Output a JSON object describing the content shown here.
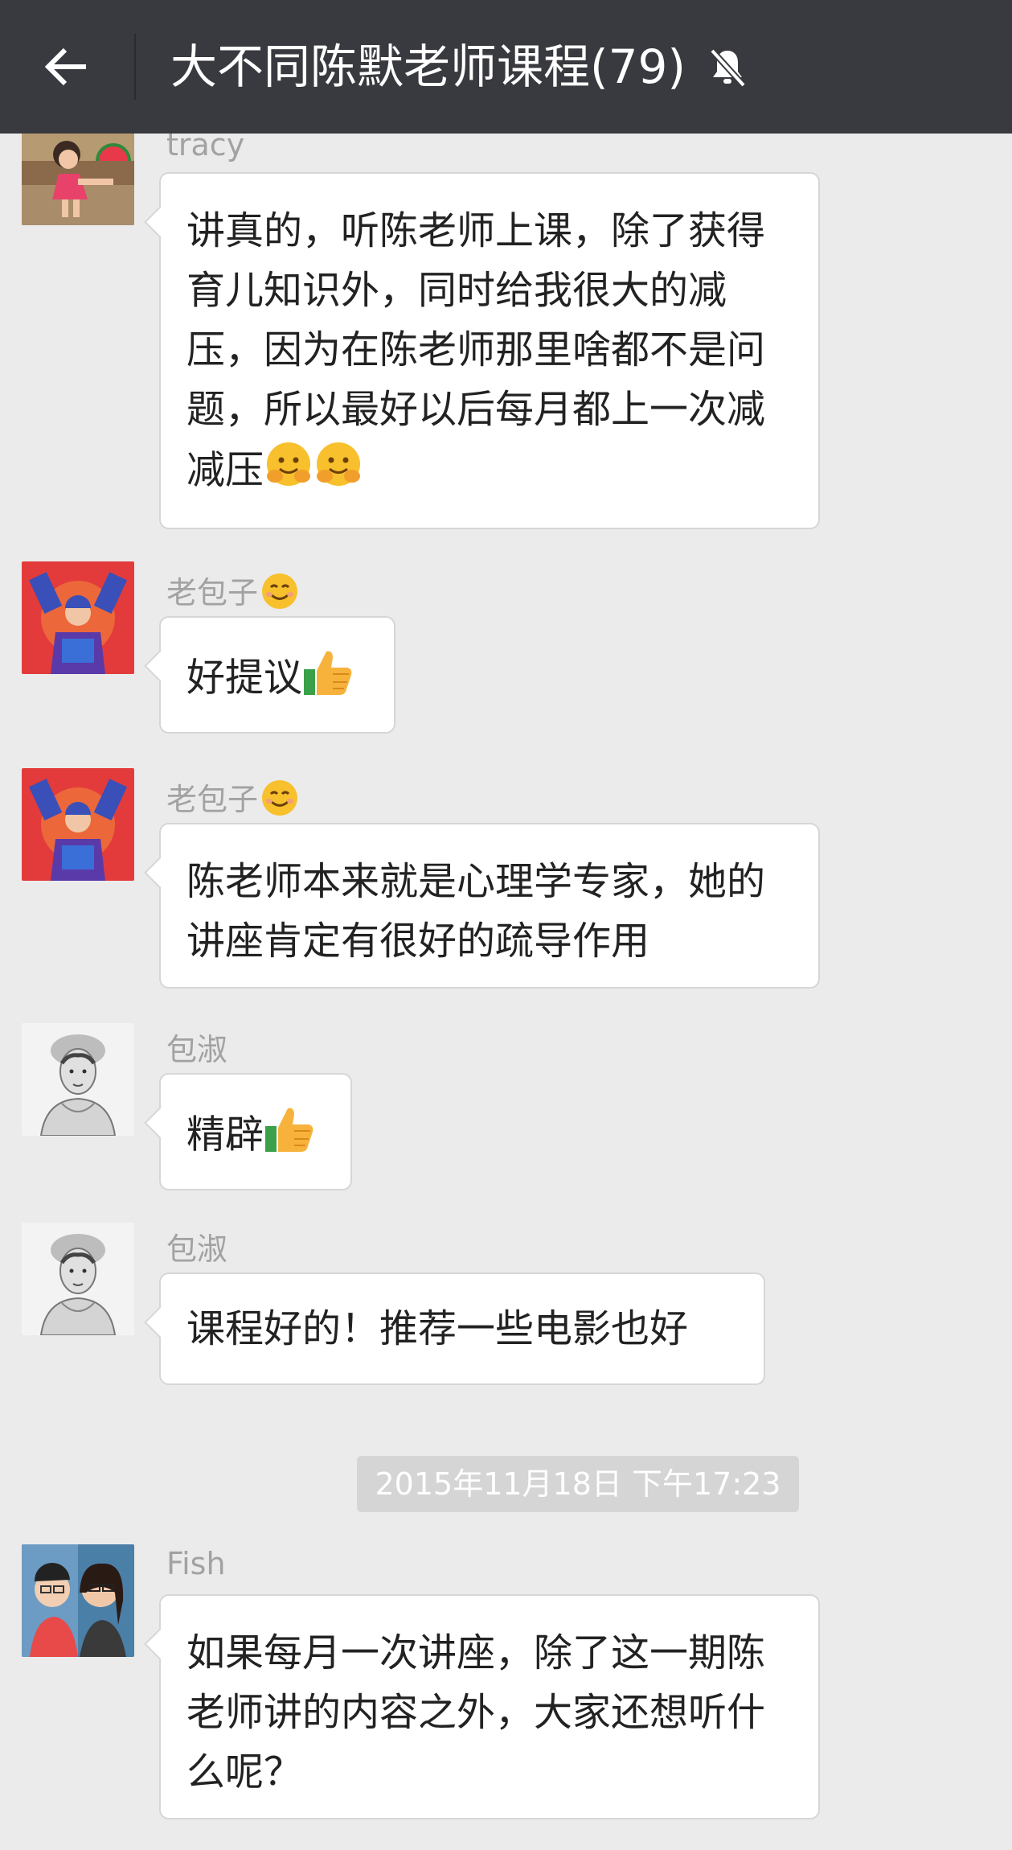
{
  "header": {
    "title": "大不同陈默老师课程(79)",
    "back_icon": "arrow-left-icon",
    "mute_icon": "bell-muted-icon"
  },
  "messages": [
    {
      "sender": "tracy",
      "avatar": "girl-with-watermelon-photo",
      "text": "讲真的，听陈老师上课，除了获得育儿知识外，同时给我很大的减压，因为在陈老师那里啥都不是问题，所以最好以后每月都上一次减减压",
      "emoji": [
        "hugging-face-emoji",
        "hugging-face-emoji"
      ]
    },
    {
      "sender": "老包子",
      "avatar": "child-in-blue-costume-photo",
      "name_emoji": "smiling-face-emoji",
      "text": "好提议",
      "emoji": [
        "thumbs-up-emoji"
      ]
    },
    {
      "sender": "老包子",
      "avatar": "child-in-blue-costume-photo",
      "name_emoji": "smiling-face-emoji",
      "text": "陈老师本来就是心理学专家，她的讲座肯定有很好的疏导作用"
    },
    {
      "sender": "包淑",
      "avatar": "vintage-portrait-sketch",
      "text": "精辟",
      "emoji": [
        "thumbs-up-emoji"
      ]
    },
    {
      "sender": "包淑",
      "avatar": "vintage-portrait-sketch",
      "text": "课程好的！推荐一些电影也好"
    },
    {
      "sender": "Fish",
      "avatar": "mother-and-child-photo",
      "text": "如果每月一次讲座，除了这一期陈老师讲的内容之外，大家还想听什么呢？"
    }
  ],
  "timestamp": "2015年11月18日 下午17:23",
  "colors": {
    "topbar": "#393a3f",
    "chat_background": "#ebebeb",
    "bubble": "#ffffff",
    "name_text": "#a2a2a2",
    "timestamp_bg": "#d5d5d5"
  }
}
